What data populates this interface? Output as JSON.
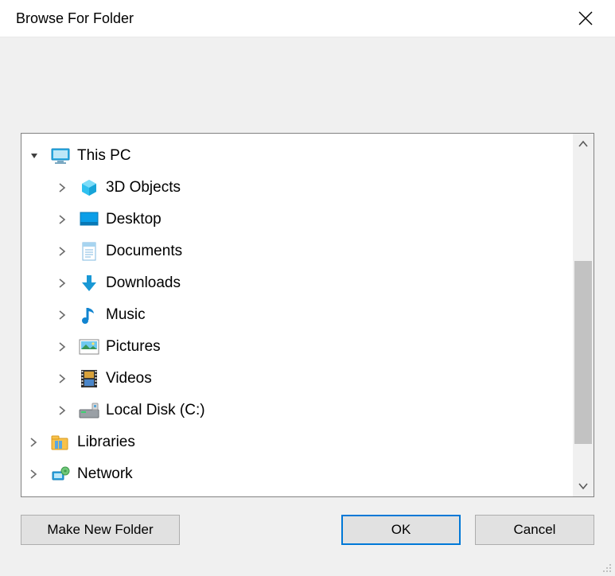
{
  "window": {
    "title": "Browse For Folder"
  },
  "tree": {
    "root": {
      "label": "This PC",
      "expanded": true
    },
    "children": [
      {
        "key": "3dobjects",
        "label": "3D Objects"
      },
      {
        "key": "desktop",
        "label": "Desktop"
      },
      {
        "key": "documents",
        "label": "Documents"
      },
      {
        "key": "downloads",
        "label": "Downloads"
      },
      {
        "key": "music",
        "label": "Music"
      },
      {
        "key": "pictures",
        "label": "Pictures"
      },
      {
        "key": "videos",
        "label": "Videos"
      },
      {
        "key": "localdisk",
        "label": "Local Disk (C:)"
      }
    ],
    "siblings": [
      {
        "key": "libraries",
        "label": "Libraries"
      },
      {
        "key": "network",
        "label": "Network"
      }
    ]
  },
  "buttons": {
    "make_new_folder": "Make New Folder",
    "ok": "OK",
    "cancel": "Cancel"
  }
}
